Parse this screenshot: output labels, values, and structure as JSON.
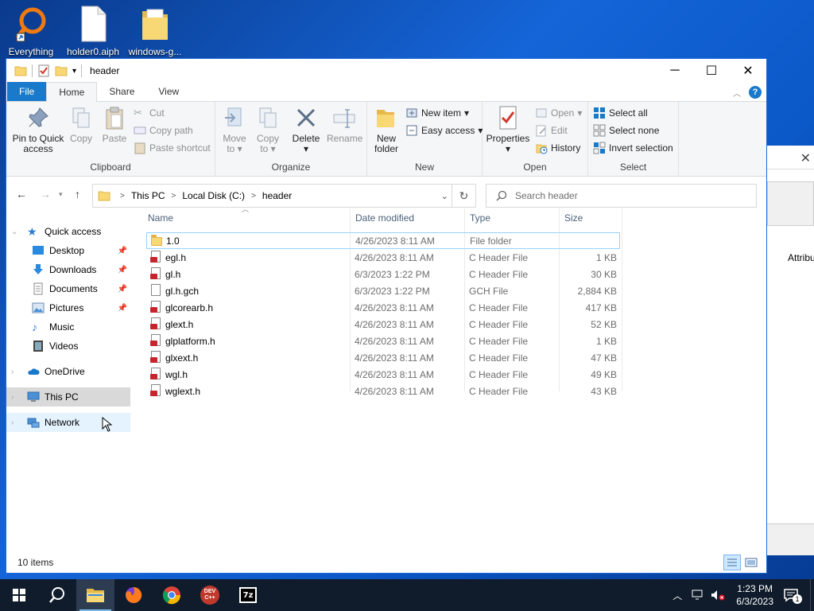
{
  "desktop": {
    "icons": [
      {
        "label": "Everything"
      },
      {
        "label": "holder0.aiph"
      },
      {
        "label": "windows-g..."
      }
    ]
  },
  "background_window": {
    "partial_text": "Attribu"
  },
  "window": {
    "title": "header",
    "tabs": [
      {
        "label": "File"
      },
      {
        "label": "Home"
      },
      {
        "label": "Share"
      },
      {
        "label": "View"
      }
    ],
    "help_label": "?"
  },
  "ribbon": {
    "clipboard": {
      "name": "Clipboard",
      "pin_label_1": "Pin to Quick",
      "pin_label_2": "access",
      "copy": "Copy",
      "paste": "Paste",
      "cut": "Cut",
      "copy_path": "Copy path",
      "paste_shortcut": "Paste shortcut"
    },
    "organize": {
      "name": "Organize",
      "move_1": "Move",
      "move_2": "to",
      "copy_1": "Copy",
      "copy_2": "to",
      "delete": "Delete",
      "rename": "Rename"
    },
    "new": {
      "name": "New",
      "new_folder_1": "New",
      "new_folder_2": "folder",
      "new_item": "New item",
      "easy_access": "Easy access"
    },
    "open": {
      "name": "Open",
      "properties": "Properties",
      "open": "Open",
      "edit": "Edit",
      "history": "History"
    },
    "select": {
      "name": "Select",
      "select_all": "Select all",
      "select_none": "Select none",
      "invert_selection": "Invert selection"
    }
  },
  "address": {
    "crumbs": [
      "This PC",
      "Local Disk (C:)",
      "header"
    ],
    "search_placeholder": "Search header"
  },
  "nav_pane": {
    "quick_access": "Quick access",
    "items": [
      {
        "label": "Desktop",
        "pinned": true
      },
      {
        "label": "Downloads",
        "pinned": true
      },
      {
        "label": "Documents",
        "pinned": true
      },
      {
        "label": "Pictures",
        "pinned": true
      },
      {
        "label": "Music",
        "pinned": false
      },
      {
        "label": "Videos",
        "pinned": false
      }
    ],
    "onedrive": "OneDrive",
    "this_pc": "This PC",
    "network": "Network"
  },
  "file_list": {
    "columns": [
      "Name",
      "Date modified",
      "Type",
      "Size"
    ],
    "rows": [
      {
        "name": "1.0",
        "date": "4/26/2023 8:11 AM",
        "type": "File folder",
        "size": "",
        "icon": "folder-icon"
      },
      {
        "name": "egl.h",
        "date": "4/26/2023 8:11 AM",
        "type": "C Header File",
        "size": "1 KB",
        "icon": "header-file-icon"
      },
      {
        "name": "gl.h",
        "date": "6/3/2023 1:22 PM",
        "type": "C Header File",
        "size": "30 KB",
        "icon": "header-file-icon"
      },
      {
        "name": "gl.h.gch",
        "date": "6/3/2023 1:22 PM",
        "type": "GCH File",
        "size": "2,884 KB",
        "icon": "generic-file-icon"
      },
      {
        "name": "glcorearb.h",
        "date": "4/26/2023 8:11 AM",
        "type": "C Header File",
        "size": "417 KB",
        "icon": "header-file-icon"
      },
      {
        "name": "glext.h",
        "date": "4/26/2023 8:11 AM",
        "type": "C Header File",
        "size": "52 KB",
        "icon": "header-file-icon"
      },
      {
        "name": "glplatform.h",
        "date": "4/26/2023 8:11 AM",
        "type": "C Header File",
        "size": "1 KB",
        "icon": "header-file-icon"
      },
      {
        "name": "glxext.h",
        "date": "4/26/2023 8:11 AM",
        "type": "C Header File",
        "size": "47 KB",
        "icon": "header-file-icon"
      },
      {
        "name": "wgl.h",
        "date": "4/26/2023 8:11 AM",
        "type": "C Header File",
        "size": "49 KB",
        "icon": "header-file-icon"
      },
      {
        "name": "wglext.h",
        "date": "4/26/2023 8:11 AM",
        "type": "C Header File",
        "size": "43 KB",
        "icon": "header-file-icon"
      }
    ]
  },
  "status_bar": {
    "item_count": "10 items"
  },
  "taskbar": {
    "apps": [
      "start",
      "search",
      "file-explorer",
      "firefox",
      "chrome",
      "dev-cpp",
      "7zip"
    ],
    "dev_label": "DEV C++",
    "sevenzip_label": "7z",
    "time": "1:23 PM",
    "date": "6/3/2023",
    "notification_count": "1"
  },
  "colors": {
    "accent": "#1979ca",
    "file_tab": "#1979ca",
    "taskbar": "#101c2c",
    "selection": "#cce8ff"
  }
}
